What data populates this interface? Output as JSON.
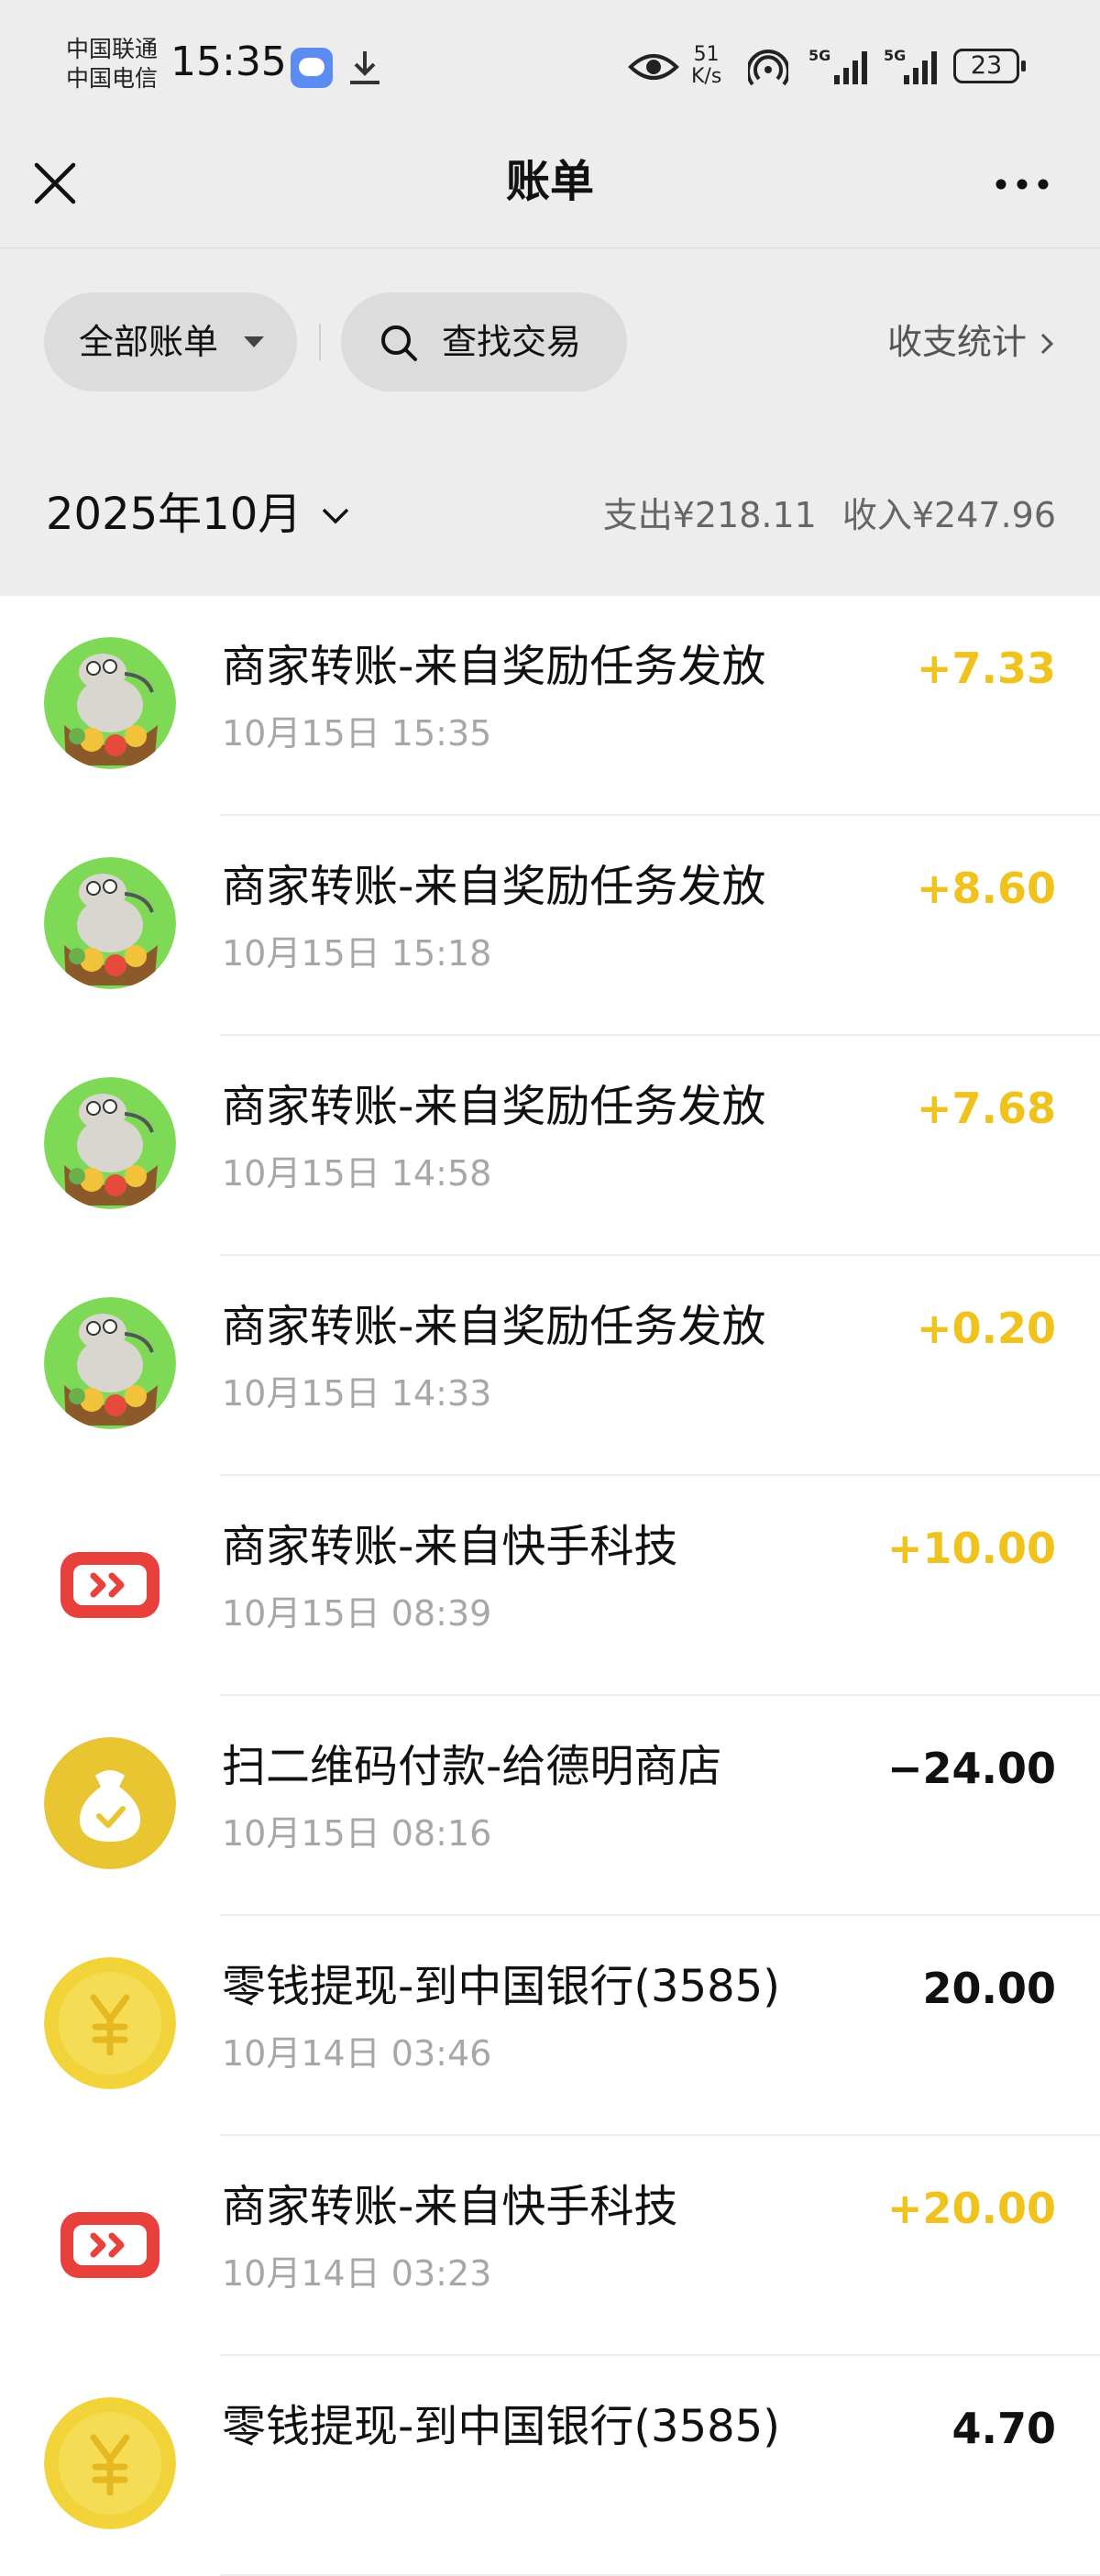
{
  "status_bar": {
    "carrier_1": "中国联通",
    "carrier_2": "中国电信",
    "time": "15:35",
    "speed_value": "51",
    "speed_unit": "K/s",
    "battery": "23",
    "icons": [
      "message-icon",
      "download-icon",
      "eye-icon",
      "hotspot-icon",
      "signal-5g-icon",
      "signal-5g-icon",
      "battery-icon"
    ]
  },
  "nav": {
    "title": "账单",
    "close_icon": "close-icon",
    "more_icon": "more-icon"
  },
  "filters": {
    "all_bills": "全部账单",
    "search": "查找交易",
    "stats": "收支统计"
  },
  "month": {
    "label": "2025年10月",
    "expense_label": "支出",
    "expense_value": "¥218.11",
    "income_label": "收入",
    "income_value": "¥247.96"
  },
  "colors": {
    "income": "#f0c21d",
    "expense": "#111111",
    "header_bg": "#ededed",
    "wallet_yellow": "#f0c21d"
  },
  "transactions": [
    {
      "title": "商家转账-来自奖励任务发放",
      "time": "10月15日 15:35",
      "amount": "+7.33",
      "type": "income",
      "icon": "mascot-avatar-icon"
    },
    {
      "title": "商家转账-来自奖励任务发放",
      "time": "10月15日 15:18",
      "amount": "+8.60",
      "type": "income",
      "icon": "mascot-avatar-icon"
    },
    {
      "title": "商家转账-来自奖励任务发放",
      "time": "10月15日 14:58",
      "amount": "+7.68",
      "type": "income",
      "icon": "mascot-avatar-icon"
    },
    {
      "title": "商家转账-来自奖励任务发放",
      "time": "10月15日 14:33",
      "amount": "+0.20",
      "type": "income",
      "icon": "mascot-avatar-icon"
    },
    {
      "title": "商家转账-来自快手科技",
      "time": "10月15日 08:39",
      "amount": "+10.00",
      "type": "income",
      "icon": "kuaishou-logo-icon"
    },
    {
      "title": "扫二维码付款-给德明商店",
      "time": "10月15日 08:16",
      "amount": "−24.00",
      "type": "expense",
      "icon": "money-bag-icon"
    },
    {
      "title": "零钱提现-到中国银行(3585)",
      "time": "10月14日 03:46",
      "amount": "20.00",
      "type": "expense",
      "icon": "yuan-coin-icon"
    },
    {
      "title": "商家转账-来自快手科技",
      "time": "10月14日 03:23",
      "amount": "+20.00",
      "type": "income",
      "icon": "kuaishou-logo-icon"
    },
    {
      "title": "零钱提现-到中国银行(3585)",
      "time": "",
      "amount": "4.70",
      "type": "expense",
      "icon": "yuan-coin-icon"
    }
  ]
}
